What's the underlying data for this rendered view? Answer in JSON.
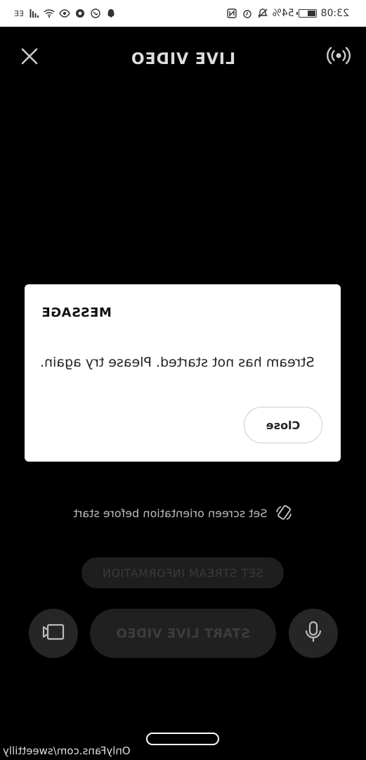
{
  "status_bar": {
    "time": "23:08",
    "battery_percent": "54%",
    "battery_level": 0.54,
    "carrier": "EE"
  },
  "header": {
    "title": "LIVE VIDEO"
  },
  "dialog": {
    "title": "MESSAGE",
    "message": "Stream has not started. Please try again.",
    "close_label": "Close"
  },
  "hint": {
    "orientation_text": "Set screen orientation before start"
  },
  "controls": {
    "set_stream_info_label": "SET STREAM INFORMATION",
    "start_live_label": "START LIVE VIDEO"
  },
  "watermark": "OnlyFans.com/sweettilly",
  "icons": {
    "close": "close-icon",
    "broadcast": "broadcast-icon",
    "rotate": "rotate-icon",
    "flip_camera": "flip-camera-icon",
    "mic": "microphone-icon"
  }
}
